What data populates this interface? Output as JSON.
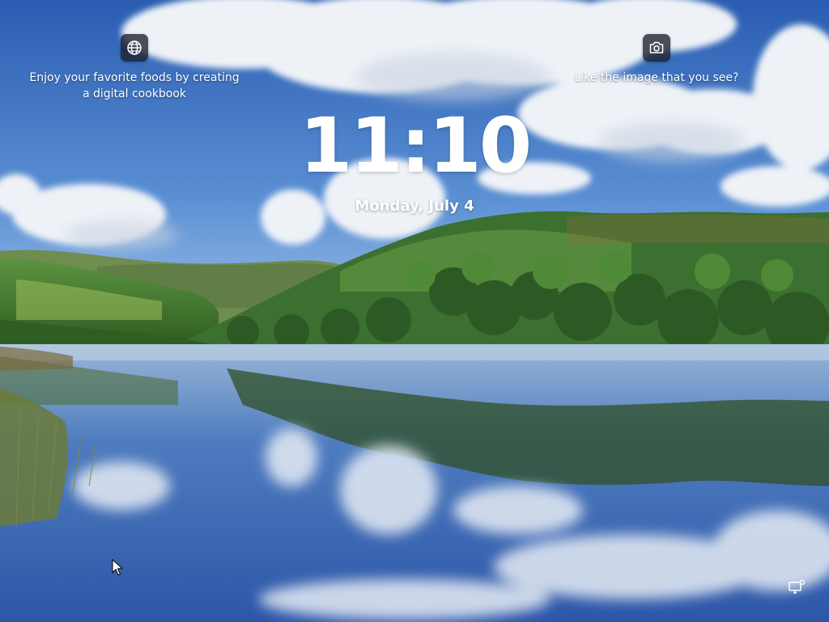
{
  "lock_screen": {
    "left_widget": {
      "icon": "globe-icon",
      "text": "Enjoy your favorite foods by creating a digital cookbook"
    },
    "right_widget": {
      "icon": "camera-icon",
      "text": "Like the image that you see?"
    },
    "time": "11:10",
    "date": "Monday, July 4",
    "status_icons": [
      "network-icon"
    ]
  },
  "colors": {
    "sky_top": "#2d62b6",
    "sky_low": "#8db8e6",
    "hills": "#3f7a2e",
    "water": "#3d6bb3",
    "widget_button": "#1c202c"
  }
}
